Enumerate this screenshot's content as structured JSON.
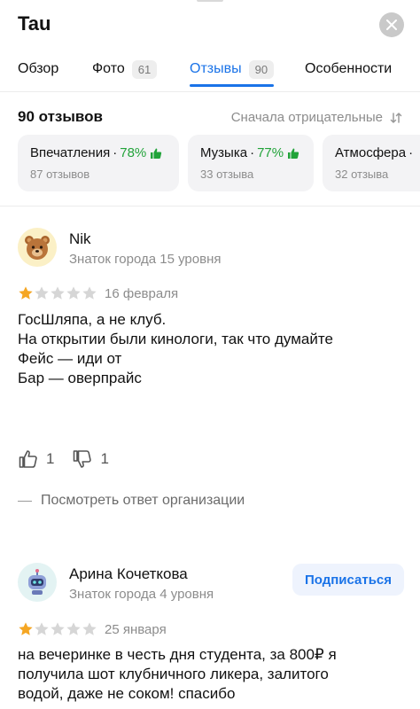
{
  "header": {
    "title": "Tau",
    "close_icon": "close-icon"
  },
  "tabs": [
    {
      "label": "Обзор",
      "count": null
    },
    {
      "label": "Фото",
      "count": "61"
    },
    {
      "label": "Отзывы",
      "count": "90",
      "active": true
    },
    {
      "label": "Особенности",
      "count": null
    }
  ],
  "summary": {
    "count_label": "90 отзывов",
    "sort_label": "Сначала отрицательные"
  },
  "chips": [
    {
      "title": "Впечатления",
      "percent": "78%",
      "sub": "87 отзывов"
    },
    {
      "title": "Музыка",
      "percent": "77%",
      "sub": "33 отзыва"
    },
    {
      "title": "Атмосфера",
      "percent": "",
      "sub": "32 отзыва"
    }
  ],
  "reviews": [
    {
      "author": "Nik",
      "level": "Знаток города 15 уровня",
      "rating": 1,
      "date": "16 февраля",
      "text_lines": [
        "ГосШляпа, а не клуб.",
        "На открытии были кинологи, так что думайте",
        "Фейс — иди от",
        "Бар — оверпрайс"
      ],
      "likes": "1",
      "dislikes": "1",
      "org_reply": "Посмотреть ответ организации",
      "avatar_icon": "bear-avatar-icon"
    },
    {
      "author": "Арина Кочеткова",
      "level": "Знаток города 4 уровня",
      "rating": 1,
      "date": "25 января",
      "text_lines": [
        "на вечеринке в честь дня студента, за 800₽ я",
        "получила шот клубничного ликера, залитого",
        "водой, даже не соком! спасибо"
      ],
      "subscribe": "Подписаться",
      "avatar_icon": "robot-avatar-icon"
    }
  ],
  "colors": {
    "accent": "#1a73e8",
    "positive": "#22a33a",
    "star_filled": "#f5a623",
    "star_empty": "#d6d6d6"
  }
}
